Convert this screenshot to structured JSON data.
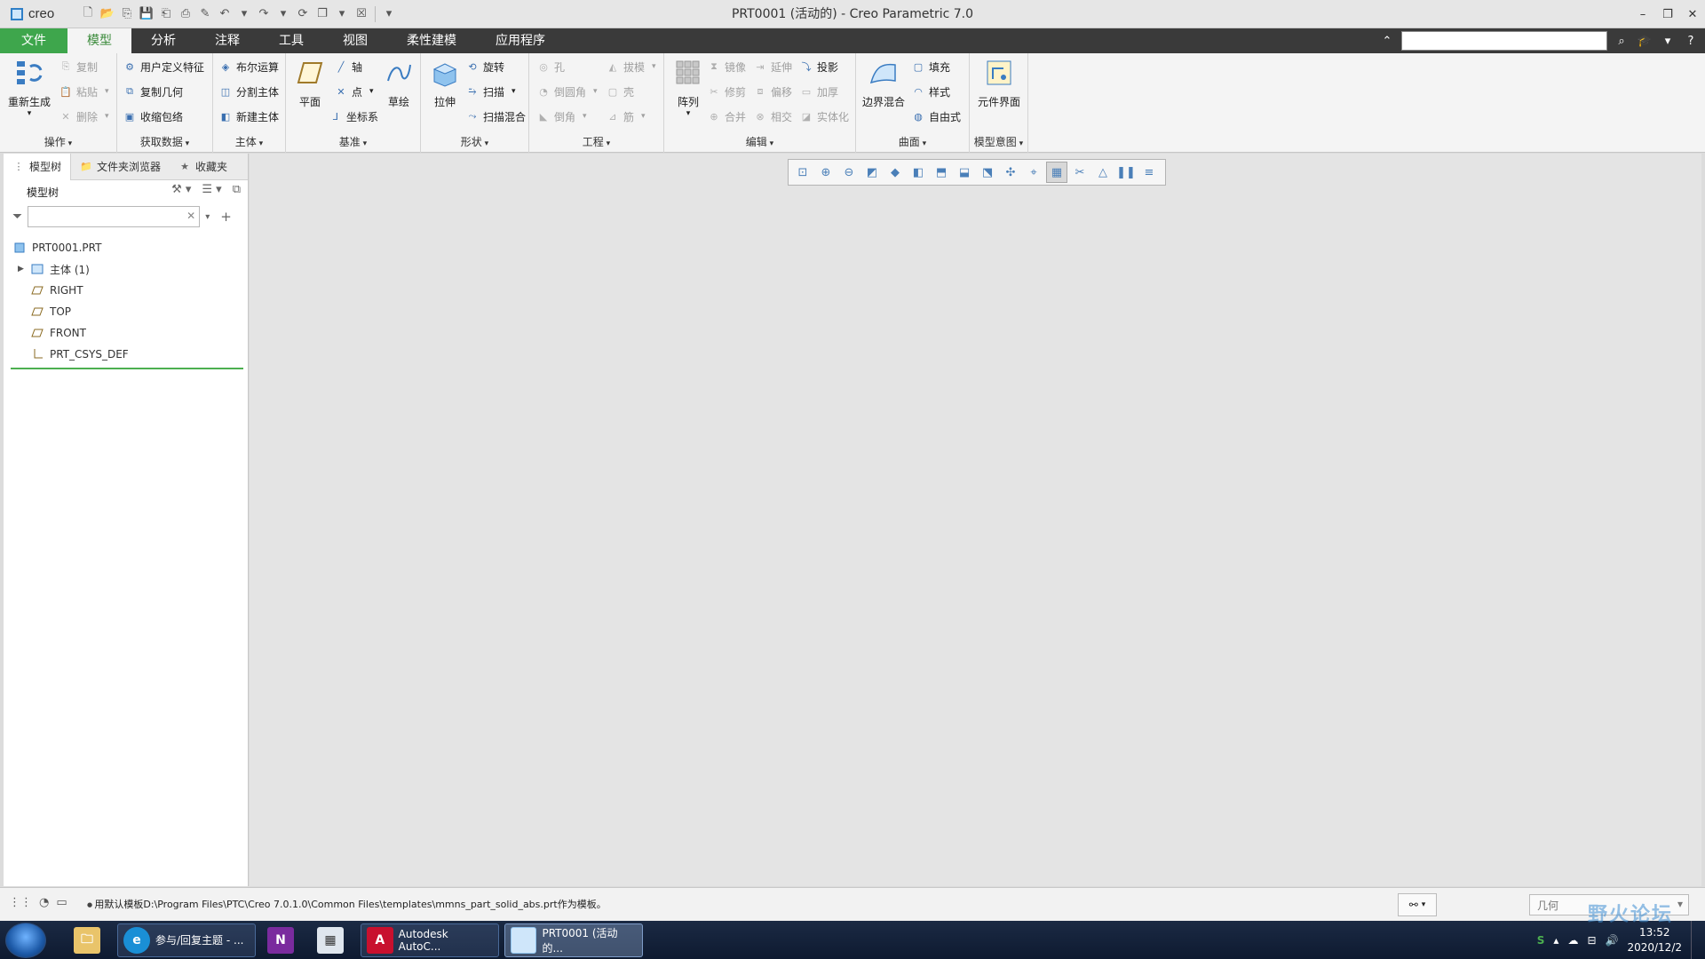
{
  "app": {
    "logo_text": "creo",
    "window_title": "PRT0001 (活动的) - Creo Parametric 7.0"
  },
  "ribbon_tabs": [
    "文件",
    "模型",
    "分析",
    "注释",
    "工具",
    "视图",
    "柔性建模",
    "应用程序"
  ],
  "ribbon": {
    "operations": {
      "label": "操作",
      "regenerate": "重新生成",
      "copy": "复制",
      "paste": "粘贴",
      "delete": "删除"
    },
    "get_data": {
      "label": "获取数据",
      "udf": "用户定义特征",
      "copy_geom": "复制几何",
      "shrinkwrap": "收缩包络"
    },
    "body": {
      "label": "主体",
      "boolean": "布尔运算",
      "split": "分割主体",
      "new": "新建主体"
    },
    "datum": {
      "label": "基准",
      "plane": "平面",
      "axis": "轴",
      "point": "点",
      "csys": "坐标系",
      "sketch": "草绘"
    },
    "shapes": {
      "label": "形状",
      "extrude": "拉伸",
      "revolve": "旋转",
      "sweep": "扫描",
      "swept_blend": "扫描混合"
    },
    "engineering": {
      "label": "工程",
      "hole": "孔",
      "round": "倒圆角",
      "chamfer": "倒角",
      "draft": "拔模",
      "shell": "壳",
      "rib": "筋"
    },
    "editing": {
      "label": "编辑",
      "pattern": "阵列",
      "mirror": "镜像",
      "trim": "修剪",
      "merge": "合并",
      "extend": "延伸",
      "offset": "偏移",
      "intersect": "相交",
      "project": "投影",
      "thicken": "加厚",
      "solidify": "实体化"
    },
    "surfaces": {
      "label": "曲面",
      "boundary_blend": "边界混合",
      "fill": "填充",
      "style": "样式",
      "freestyle": "自由式"
    },
    "model_intent": {
      "label": "模型意图",
      "component_interface": "元件界面"
    }
  },
  "left_panel": {
    "tabs": [
      "模型树",
      "文件夹浏览器",
      "收藏夹"
    ],
    "tree_header": "模型树",
    "filter_placeholder": "",
    "nodes": [
      "PRT0001.PRT",
      "主体 (1)",
      "RIGHT",
      "TOP",
      "FRONT",
      "PRT_CSYS_DEF"
    ]
  },
  "status": {
    "message": "用默认模板D:\\Program Files\\PTC\\Creo 7.0.1.0\\Common Files\\templates\\mmns_part_solid_abs.prt作为模板。",
    "filter_value": "几何"
  },
  "taskbar": {
    "apps": [
      "参与/回复主题 - ...",
      "Autodesk AutoC...",
      "PRT0001 (活动的..."
    ],
    "time": "13:52",
    "date": "2020/12/2",
    "watermark": "野火论坛"
  },
  "colors": {
    "file_tab": "#3ea64c",
    "active_tab_text": "#3a8a3a",
    "tree_underline": "#4caf50",
    "tabbar": "#3a3a3a"
  }
}
